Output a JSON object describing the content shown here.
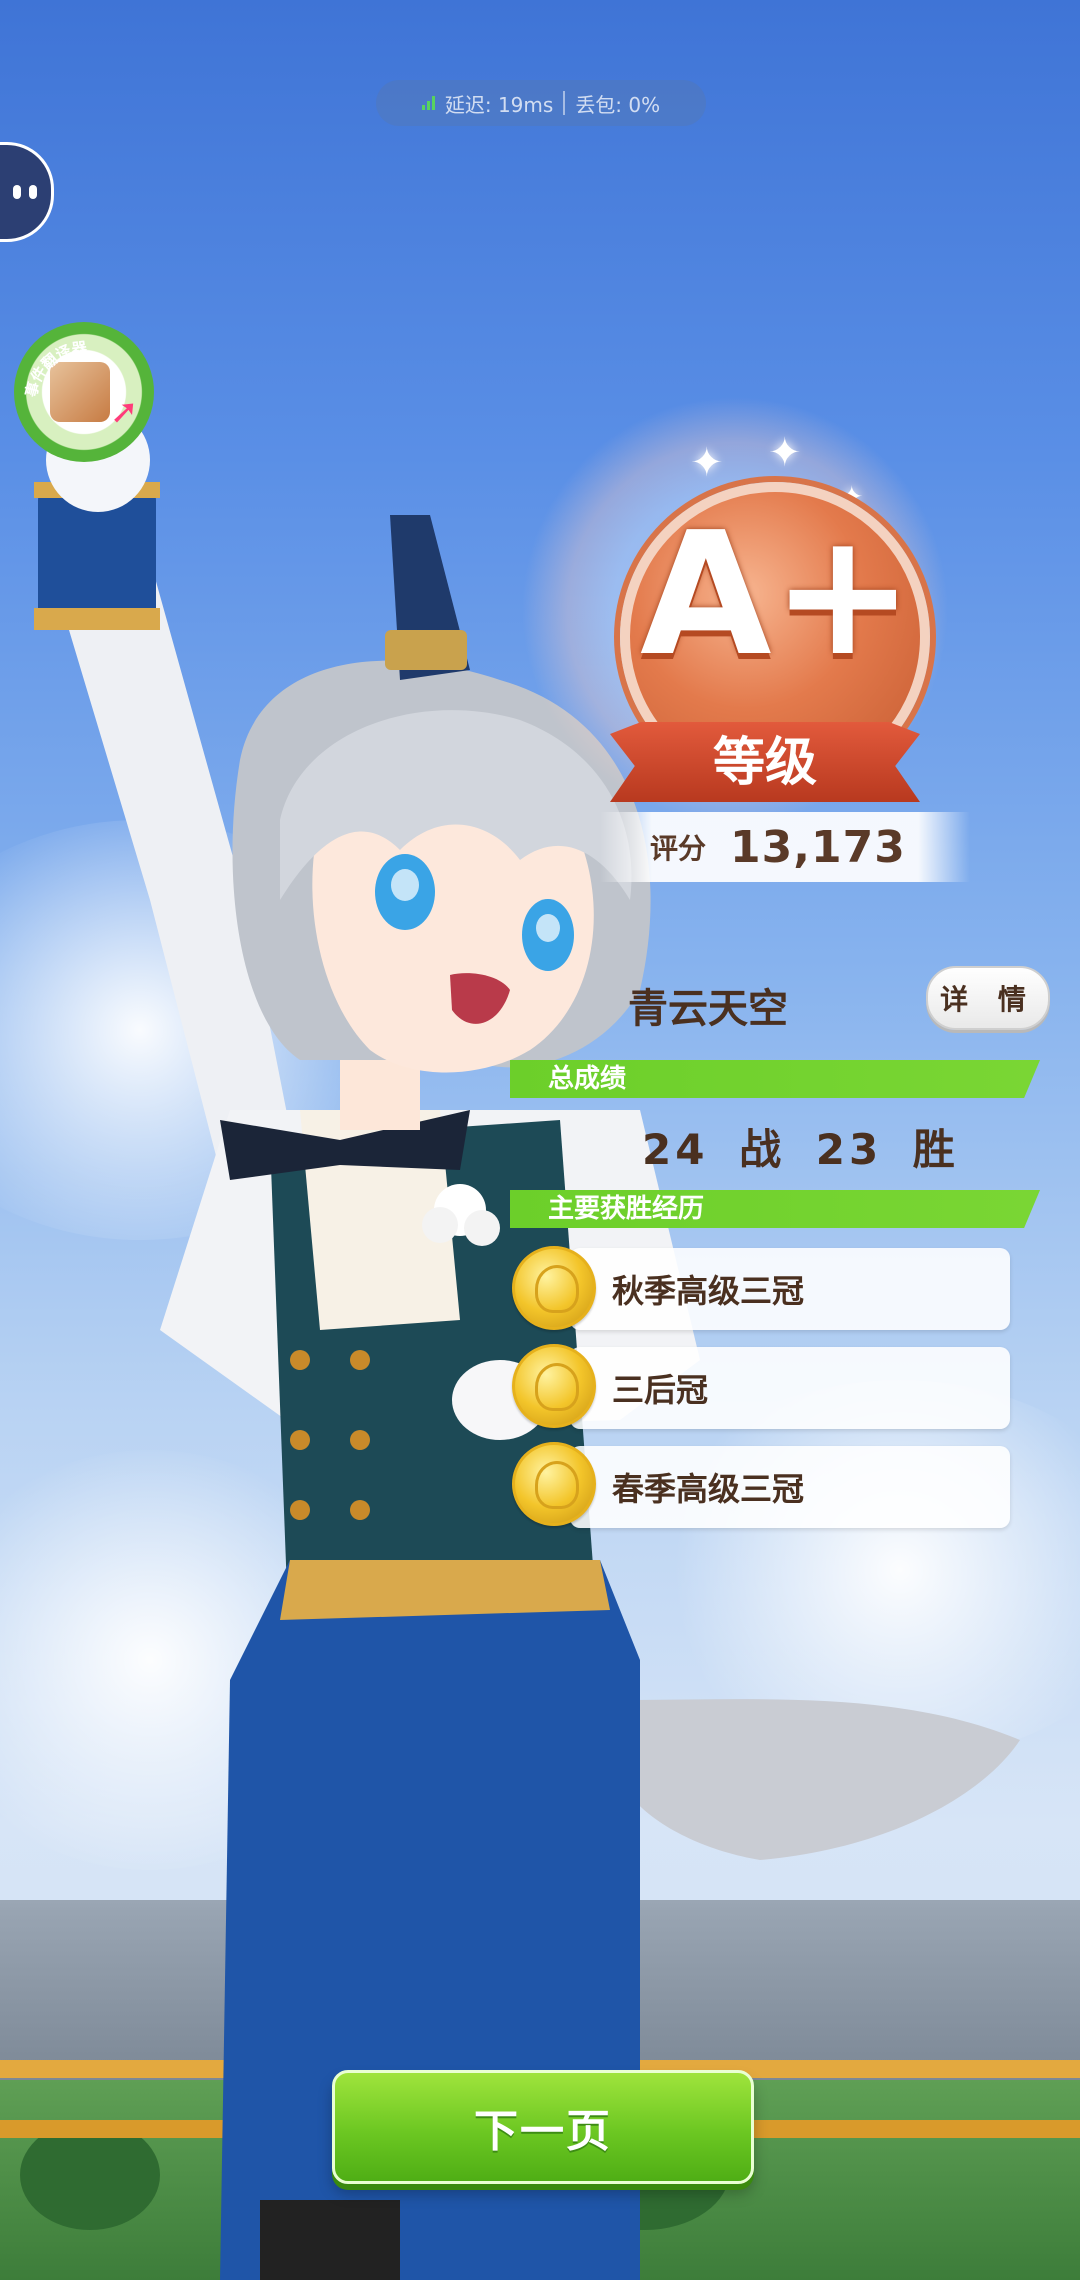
{
  "network": {
    "latency": "延迟: 19ms",
    "packet_loss": "丢包: 0%"
  },
  "translator_badge": {
    "label": "事件翻译器"
  },
  "grade": {
    "letter": "A+",
    "ribbon_label": "等级",
    "score_label": "评分",
    "score_value": "13,173"
  },
  "runner": {
    "name": "青云天空",
    "details_button": "详 情"
  },
  "overall": {
    "header": "总成绩",
    "races": "24",
    "races_unit": "战",
    "wins": "23",
    "wins_unit": "胜"
  },
  "wins_section": {
    "header": "主要获胜经历",
    "items": [
      {
        "title": "秋季高级三冠"
      },
      {
        "title": "三后冠"
      },
      {
        "title": "春季高级三冠"
      }
    ]
  },
  "footer": {
    "next_button": "下一页"
  },
  "colors": {
    "accent_green": "#6ccf2a",
    "grade_orange": "#e37a4c",
    "text_brown": "#4a3020",
    "sky_blue": "#5a8fe6"
  }
}
